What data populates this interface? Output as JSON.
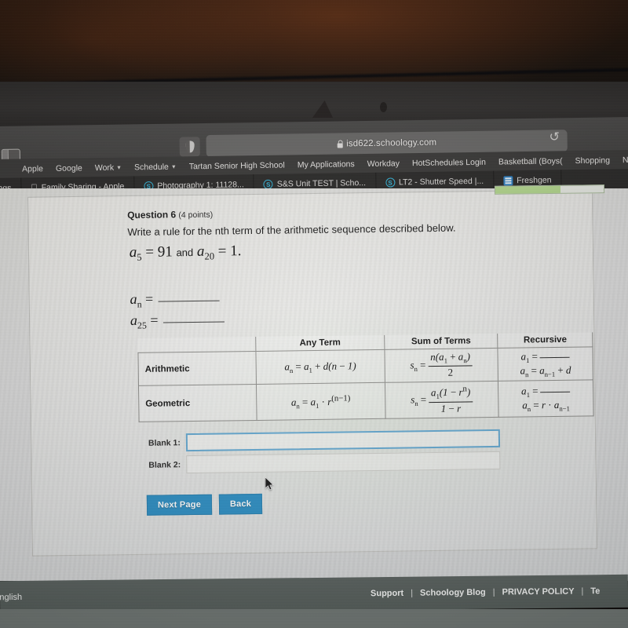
{
  "browser": {
    "url": "isd622.schoology.com",
    "lock_icon": "lock-icon",
    "shield_icon": "shield-privacy-icon",
    "reload_icon": "reload-icon",
    "sidebar_icon": "sidebar-toggle-icon",
    "bookmarks": [
      {
        "label": "Apple",
        "has_caret": false
      },
      {
        "label": "Google",
        "has_caret": false
      },
      {
        "label": "Work",
        "has_caret": true
      },
      {
        "label": "Schedule",
        "has_caret": true
      },
      {
        "label": "Tartan Senior High School",
        "has_caret": false
      },
      {
        "label": "My Applications",
        "has_caret": false
      },
      {
        "label": "Workday",
        "has_caret": false
      },
      {
        "label": "HotSchedules Login",
        "has_caret": false
      },
      {
        "label": "Basketball (Boys(",
        "has_caret": false
      },
      {
        "label": "Shopping",
        "has_caret": false
      },
      {
        "label": "NETGEAR Gateway",
        "has_caret": false
      }
    ],
    "tabs": [
      {
        "label": "Settings",
        "icon": "none"
      },
      {
        "label": "Family Sharing - Apple",
        "icon": "apple-icon"
      },
      {
        "label": "Photography 1: 11128...",
        "icon": "schoology-icon"
      },
      {
        "label": "S&S Unit TEST | Scho...",
        "icon": "schoology-icon"
      },
      {
        "label": "LT2 - Shutter Speed |...",
        "icon": "schoology-icon"
      },
      {
        "label": "Freshgen",
        "icon": "document-icon"
      }
    ]
  },
  "quiz": {
    "question_label": "Question 6",
    "points": "(4 points)",
    "prompt": "Write a rule for the nth term of the arithmetic sequence described below.",
    "given": {
      "term1": "a",
      "term1_sub": "5",
      "term1_value": "91",
      "conjunction": "and",
      "term2": "a",
      "term2_sub": "20",
      "term2_value": "1",
      "period": "."
    },
    "answer_lines": [
      {
        "symbol": "a",
        "subscript": "n",
        "equals": "="
      },
      {
        "symbol": "a",
        "subscript": "25",
        "equals": "="
      }
    ],
    "progress_percent": 60
  },
  "formula_table": {
    "column_headers": [
      "",
      "Any Term",
      "Sum of Terms",
      "Recursive"
    ],
    "rows": [
      {
        "name": "Arithmetic",
        "any_term": {
          "lhs": "a",
          "lhs_sub": "n",
          "rhs": "a₁ + d(n − 1)"
        },
        "sum_of_terms": {
          "lhs": "s",
          "lhs_sub": "n",
          "numerator": "n(a₁ + aₙ)",
          "denominator": "2"
        },
        "recursive": {
          "line1": "a₁ = ____",
          "line2": "aₙ = aₙ₋₁ + d"
        }
      },
      {
        "name": "Geometric",
        "any_term": {
          "lhs": "a",
          "lhs_sub": "n",
          "rhs": "a₁ · r⁽ⁿ⁻¹⁾"
        },
        "sum_of_terms": {
          "lhs": "s",
          "lhs_sub": "n",
          "numerator": "a₁(1 − rⁿ)",
          "denominator": "1 − r"
        },
        "recursive": {
          "line1": "a₁ = ____",
          "line2": "aₙ = r · aₙ₋₁"
        }
      }
    ]
  },
  "blanks": [
    {
      "label": "Blank 1:",
      "value": "",
      "focused": true
    },
    {
      "label": "Blank 2:",
      "value": "",
      "focused": false
    }
  ],
  "buttons": {
    "next_page": "Next Page",
    "back": "Back"
  },
  "footer": {
    "language": "English",
    "links": [
      "Support",
      "Schoology Blog",
      "PRIVACY POLICY",
      "Te"
    ],
    "separator": "|"
  },
  "colors": {
    "schoology_blue": "#2e8fc4",
    "focus_border": "#63a7cf",
    "progress_green": "#b5d98f",
    "footer_gray": "#5a625f"
  }
}
